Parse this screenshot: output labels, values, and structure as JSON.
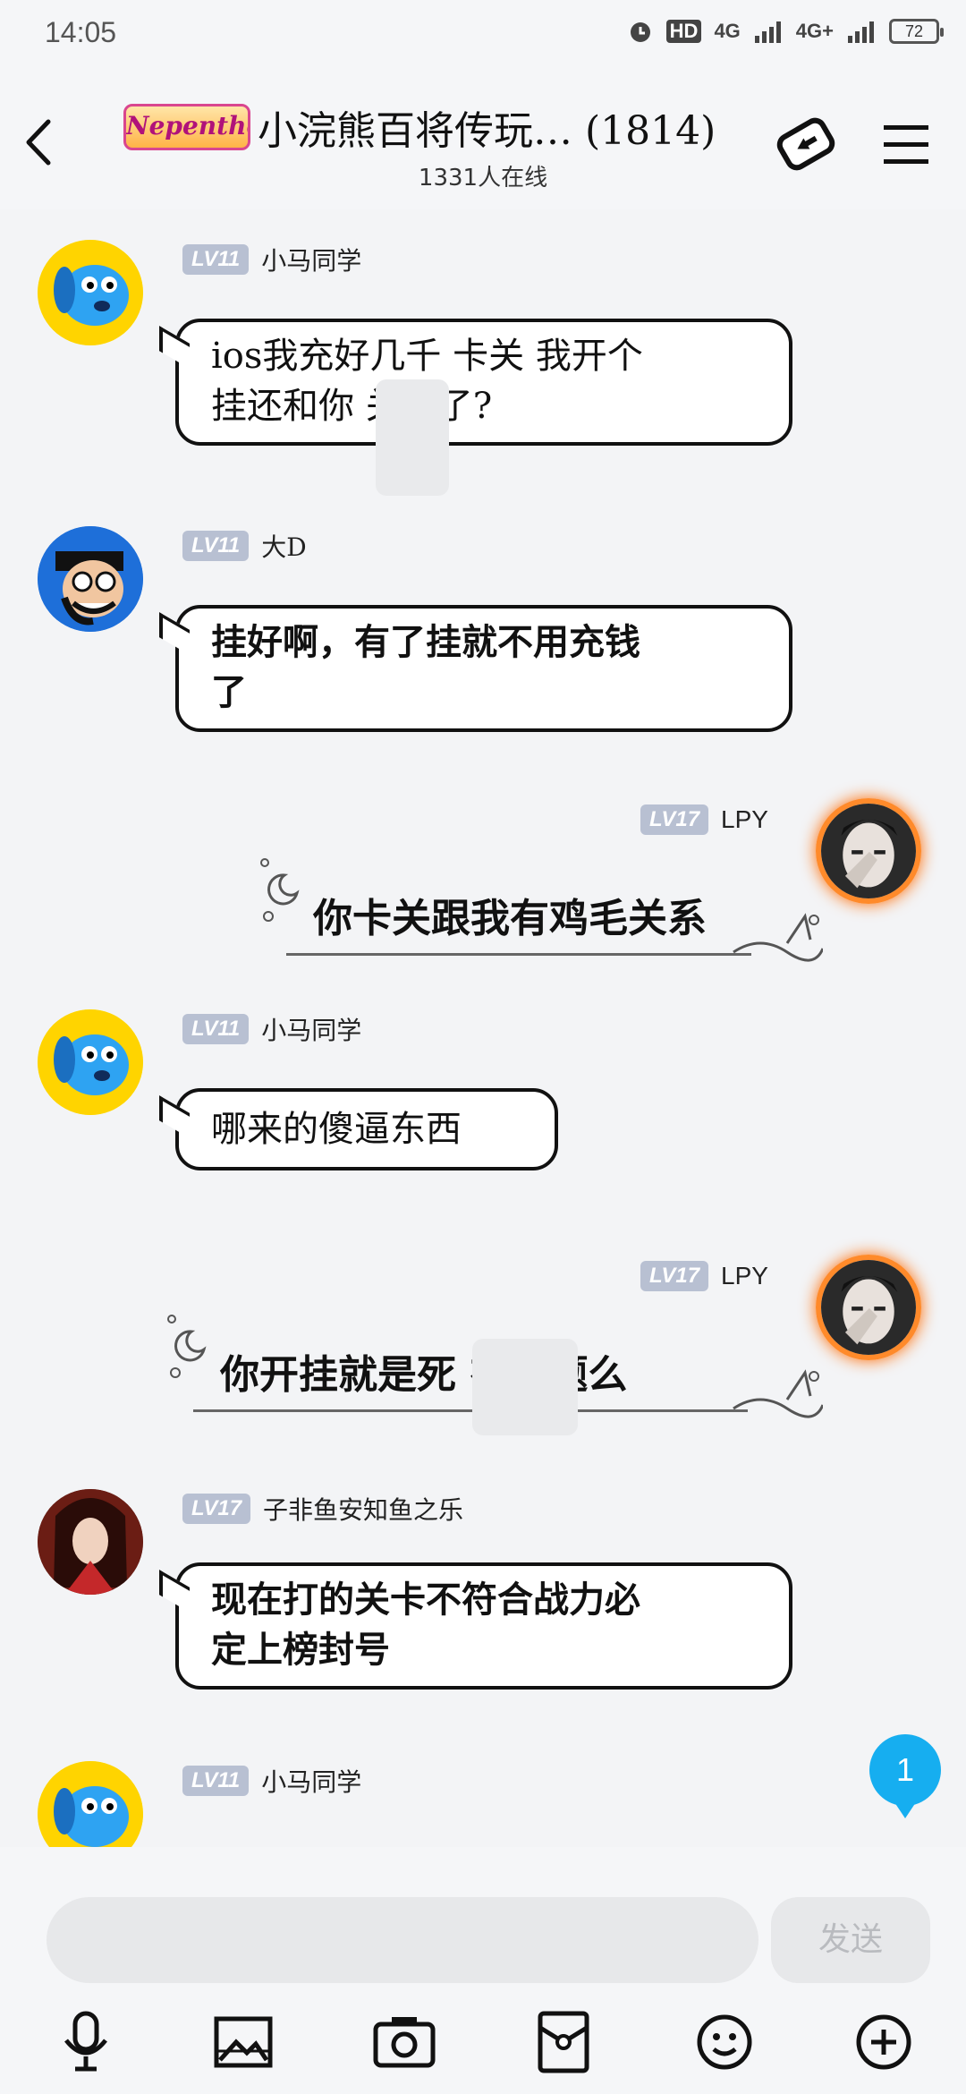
{
  "status_bar": {
    "time": "14:05",
    "icons": [
      "alarm-icon",
      "hd-icon",
      "4g-signal-icon",
      "4g-plus-signal-icon"
    ],
    "hd_label": "HD",
    "network_1": "4G",
    "network_2": "4G+",
    "battery": "72"
  },
  "header": {
    "logo_text": "Nepenthe",
    "title": "小浣熊百将传玩… (1814)",
    "online": "1331人在线"
  },
  "messages": [
    {
      "level": "LV11",
      "name": "小马同学",
      "text_line1": "ios我充好几千 卡关 我开个",
      "text_line2": "挂还和你  关联了?"
    },
    {
      "level": "LV11",
      "name": "大D",
      "text_line1": "挂好啊，有了挂就不用充钱",
      "text_line2": "了"
    },
    {
      "level": "LV17",
      "name": "LPY",
      "text": "你卡关跟我有鸡毛关系"
    },
    {
      "level": "LV11",
      "name": "小马同学",
      "text": "哪来的傻逼东西"
    },
    {
      "level": "LV17",
      "name": "LPY",
      "text": "你开挂就是死      有问题么"
    },
    {
      "level": "LV17",
      "name": "子非鱼安知鱼之乐",
      "text_line1": "现在打的关卡不符合战力必",
      "text_line2": "定上榜封号"
    },
    {
      "level": "LV11",
      "name": "小马同学"
    }
  ],
  "unread_count": "1",
  "input": {
    "placeholder": "",
    "send_label": "发送"
  },
  "toolbar": [
    "microphone-icon",
    "image-icon",
    "camera-icon",
    "red-packet-icon",
    "emoji-icon",
    "plus-icon"
  ],
  "colors": {
    "accent": "#16aef0",
    "level_badge": "#b8c0d2",
    "background": "#f3f4f6"
  }
}
